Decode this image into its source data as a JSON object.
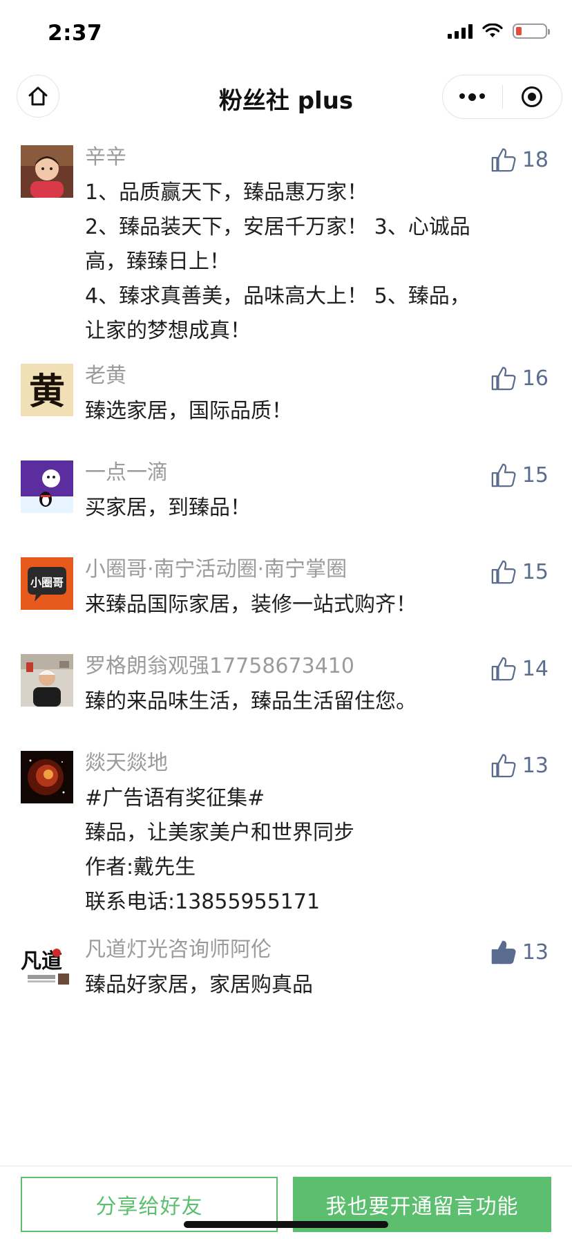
{
  "status_bar": {
    "time": "2:37"
  },
  "nav": {
    "title": "粉丝社 plus"
  },
  "comments": [
    {
      "name": "辛辛",
      "likes": "18",
      "lines": [
        "1、品质赢天下，臻品惠万家！",
        "2、臻品装天下，安居千万家！  3、心诚品高，臻臻日上！",
        "4、臻求真善美，品味高大上！  5、臻品，让家的梦想成真！"
      ],
      "liked": false
    },
    {
      "name": "老黄",
      "likes": "16",
      "lines": [
        "臻选家居，国际品质！"
      ],
      "liked": false
    },
    {
      "name": "一点一滴",
      "likes": "15",
      "lines": [
        "买家居，到臻品！"
      ],
      "liked": false
    },
    {
      "name": "小圈哥·南宁活动圈·南宁掌圈",
      "likes": "15",
      "lines": [
        "来臻品国际家居，装修一站式购齐！"
      ],
      "liked": false
    },
    {
      "name": "罗格朗翁观强17758673410",
      "likes": "14",
      "lines": [
        "臻的来品味生活，臻品生活留住您。"
      ],
      "liked": false
    },
    {
      "name": "燚天燚地",
      "likes": "13",
      "lines": [
        "#广告语有奖征集#",
        "臻品，让美家美户和世界同步",
        "作者:戴先生",
        "联系电话:13855955171"
      ],
      "liked": false
    },
    {
      "name": "凡道灯光咨询师阿伦",
      "likes": "13",
      "lines": [
        "臻品好家居，家居购真品"
      ],
      "liked": true
    }
  ],
  "avatars": {
    "c1": "child-photo",
    "c2_glyph": "黄",
    "c3": "penguin-illustration",
    "c4_text": "小圈哥",
    "c5": "man-photo",
    "c6": "nebula-image",
    "c7_logo_text": "凡道"
  },
  "footer": {
    "share_label": "分享给好友",
    "open_label": "我也要开通留言功能"
  },
  "colors": {
    "accent_green": "#5cbf6f",
    "like_blue": "#5a6c8f"
  }
}
